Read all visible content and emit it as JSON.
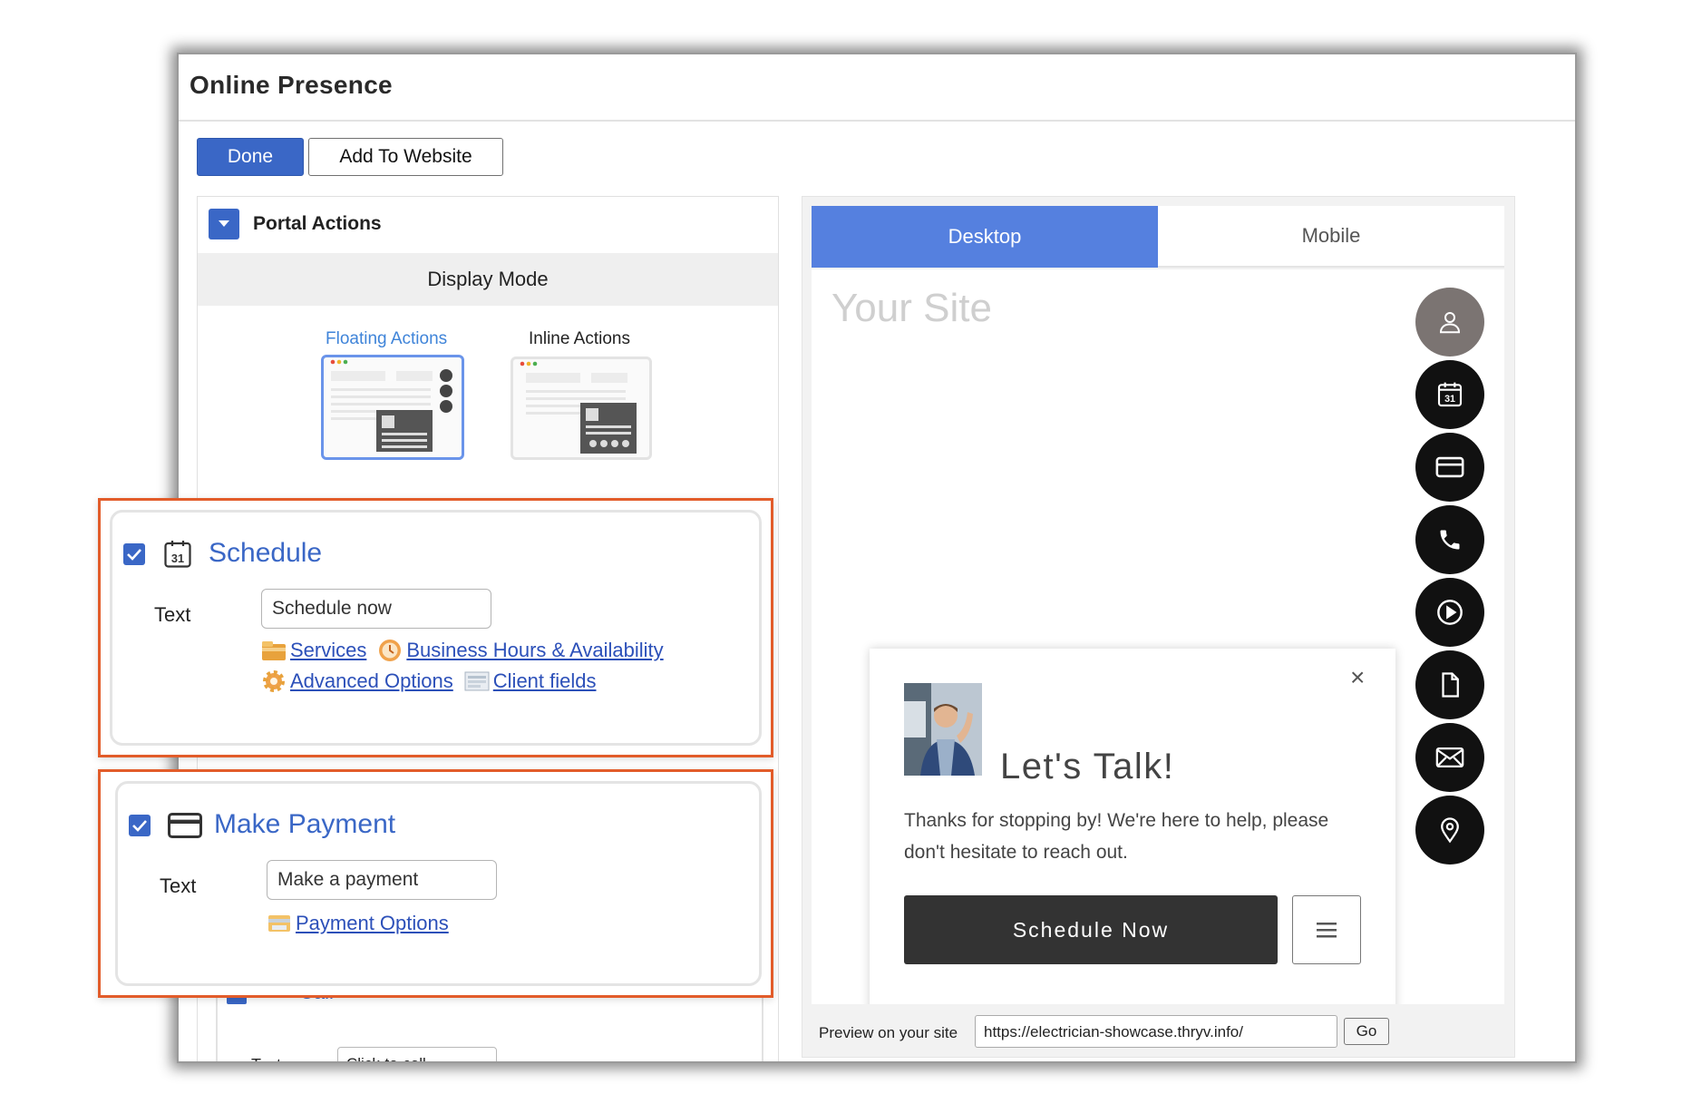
{
  "window": {
    "title": "Online Presence",
    "done_label": "Done",
    "add_to_website_label": "Add To Website"
  },
  "portal": {
    "section_title": "Portal Actions",
    "display_mode_title": "Display Mode",
    "modes": [
      {
        "label": "Floating Actions",
        "selected": true
      },
      {
        "label": "Inline Actions",
        "selected": false
      }
    ]
  },
  "actions": {
    "schedule": {
      "title": "Schedule",
      "checked": true,
      "icon": "calendar-icon",
      "text_label": "Text",
      "text_value": "Schedule now",
      "links": [
        "Services",
        "Business Hours & Availability",
        "Advanced Options",
        "Client fields"
      ]
    },
    "payment": {
      "title": "Make Payment",
      "checked": true,
      "icon": "credit-card-icon",
      "text_label": "Text",
      "text_value": "Make a payment",
      "links": [
        "Payment Options"
      ]
    },
    "call": {
      "title": "Call",
      "text_label": "Text",
      "text_value": "Click-to-call"
    }
  },
  "preview": {
    "tabs": [
      {
        "label": "Desktop",
        "active": true
      },
      {
        "label": "Mobile",
        "active": false
      }
    ],
    "site_placeholder": "Your Site",
    "floating_icons": [
      "user-icon",
      "calendar-icon",
      "credit-card-icon",
      "phone-icon",
      "play-icon",
      "document-icon",
      "mail-icon",
      "location-pin-icon"
    ],
    "popup": {
      "close_symbol": "×",
      "heading": "Let's Talk!",
      "body": "Thanks for stopping by! We're here to help, please don't hesitate to reach out.",
      "button_label": "Schedule Now"
    },
    "preview_label": "Preview on your site",
    "preview_url": "https://electrician-showcase.thryv.info/",
    "go_label": "Go"
  },
  "colors": {
    "accent_blue": "#3a67c6",
    "tab_blue": "#5580df",
    "highlight_orange": "#e25c2a",
    "fab_dark": "#111111",
    "fab_profile": "#7b7472"
  }
}
